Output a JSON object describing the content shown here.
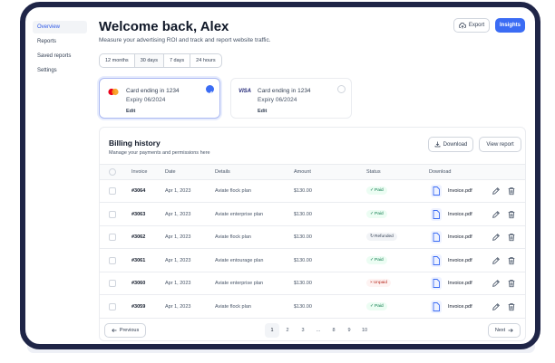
{
  "sidebar": {
    "items": [
      {
        "label": "Overview"
      },
      {
        "label": "Reports"
      },
      {
        "label": "Saved reports"
      },
      {
        "label": "Settings"
      }
    ]
  },
  "header": {
    "title": "Welcome back, Alex",
    "subtitle": "Measure your advertising ROI and track and report website traffic.",
    "export_label": "Export",
    "insights_label": "Insights"
  },
  "ranges": [
    {
      "label": "12 months"
    },
    {
      "label": "30 days"
    },
    {
      "label": "7 days"
    },
    {
      "label": "24 hours"
    }
  ],
  "cards": [
    {
      "title": "Card ending in 1234",
      "expiry": "Expiry 06/2024",
      "edit": "Edit",
      "brand": "mastercard-logo",
      "selected": true
    },
    {
      "title": "Card ending in 1234",
      "expiry": "Expiry 06/2024",
      "edit": "Edit",
      "brand": "visa-logo",
      "brand_text": "VISA",
      "selected": false
    }
  ],
  "billing": {
    "title": "Billing history",
    "subtitle": "Manage your payments and permissions here",
    "download_label": "Download",
    "view_report_label": "View report",
    "columns": [
      "Invoice",
      "Date",
      "Details",
      "Amount",
      "Status",
      "Download"
    ],
    "rows": [
      {
        "invoice": "#3064",
        "date": "Apr 1, 2023",
        "details": "Aviate flock plan",
        "amount": "$130.00",
        "status": "Paid",
        "file": "Invoice.pdf"
      },
      {
        "invoice": "#3063",
        "date": "Apr 1, 2023",
        "details": "Aviate enterprise plan",
        "amount": "$130.00",
        "status": "Paid",
        "file": "Invoice.pdf"
      },
      {
        "invoice": "#3062",
        "date": "Apr 1, 2023",
        "details": "Aviate flock plan",
        "amount": "$130.00",
        "status": "Refunded",
        "file": "Invoice.pdf"
      },
      {
        "invoice": "#3061",
        "date": "Apr 1, 2023",
        "details": "Aviate entourage plan",
        "amount": "$130.00",
        "status": "Paid",
        "file": "Invoice.pdf"
      },
      {
        "invoice": "#3060",
        "date": "Apr 1, 2023",
        "details": "Aviate enterprise plan",
        "amount": "$130.00",
        "status": "Unpaid",
        "file": "Invoice.pdf"
      },
      {
        "invoice": "#3059",
        "date": "Apr 1, 2023",
        "details": "Aviate flock plan",
        "amount": "$130.00",
        "status": "Paid",
        "file": "Invoice.pdf"
      }
    ]
  },
  "pagination": {
    "previous_label": "Previous",
    "next_label": "Next",
    "pages": [
      "1",
      "2",
      "3",
      "...",
      "8",
      "9",
      "10"
    ],
    "current": "1"
  },
  "colors": {
    "accent": "#3b6cf4",
    "frame": "#1f2547",
    "paid_bg": "#ecfdf3",
    "paid_fg": "#067647",
    "refunded_bg": "#f2f4f7",
    "refunded_fg": "#344054",
    "unpaid_bg": "#fef3f2",
    "unpaid_fg": "#b42318"
  }
}
